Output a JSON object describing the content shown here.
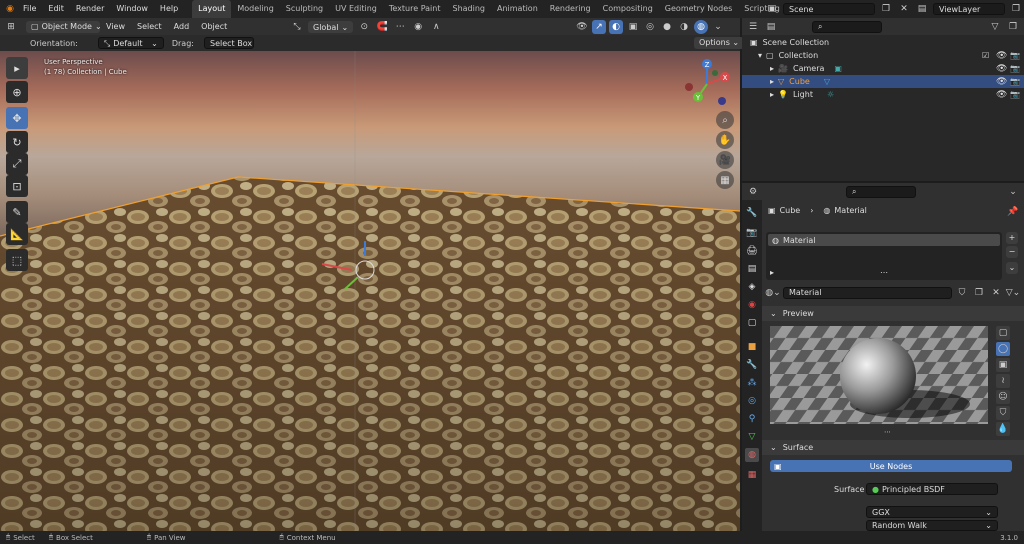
{
  "topbar": {
    "menus": [
      "File",
      "Edit",
      "Render",
      "Window",
      "Help"
    ],
    "workspaces": [
      "Layout",
      "Modeling",
      "Sculpting",
      "UV Editing",
      "Texture Paint",
      "Shading",
      "Animation",
      "Rendering",
      "Compositing",
      "Geometry Nodes",
      "Scripting"
    ],
    "active_workspace": "Layout",
    "add_tab": "+",
    "scene": "Scene",
    "view_layer": "ViewLayer"
  },
  "viewport_header": {
    "mode": "Object Mode",
    "menus": [
      "View",
      "Select",
      "Add",
      "Object"
    ],
    "transform": "Global"
  },
  "tool_header": {
    "orientation_label": "Orientation:",
    "orientation_value": "Default",
    "drag_label": "Drag:",
    "drag_value": "Select Box",
    "options": "Options"
  },
  "viewport": {
    "view_name": "User Perspective",
    "collection_info": "(1 78) Collection | Cube",
    "gizmo": {
      "x": "X",
      "y": "Y",
      "z": "Z"
    }
  },
  "outliner": {
    "items": [
      {
        "label": "Scene Collection",
        "selected": false
      },
      {
        "label": "Collection",
        "selected": false
      },
      {
        "label": "Camera",
        "selected": false
      },
      {
        "label": "Cube",
        "selected": true
      },
      {
        "label": "Light",
        "selected": false
      }
    ]
  },
  "properties": {
    "breadcrumb_object": "Cube",
    "breadcrumb_material": "Material",
    "slot_name": "Material",
    "material_name": "Material",
    "preview_label": "Preview",
    "surface_panel": "Surface",
    "use_nodes": "Use Nodes",
    "surface_label": "Surface",
    "surface_value": "Principled BSDF",
    "distribution": "GGX",
    "subsurface": "Random Walk"
  },
  "statusbar": {
    "select": "Select",
    "box_select": "Box Select",
    "pan_view": "Pan View",
    "context_menu": "Context Menu",
    "version": "3.1.0"
  },
  "colors": {
    "accent": "#4772b3",
    "selected_row": "#334d80",
    "panel": "#303030"
  }
}
